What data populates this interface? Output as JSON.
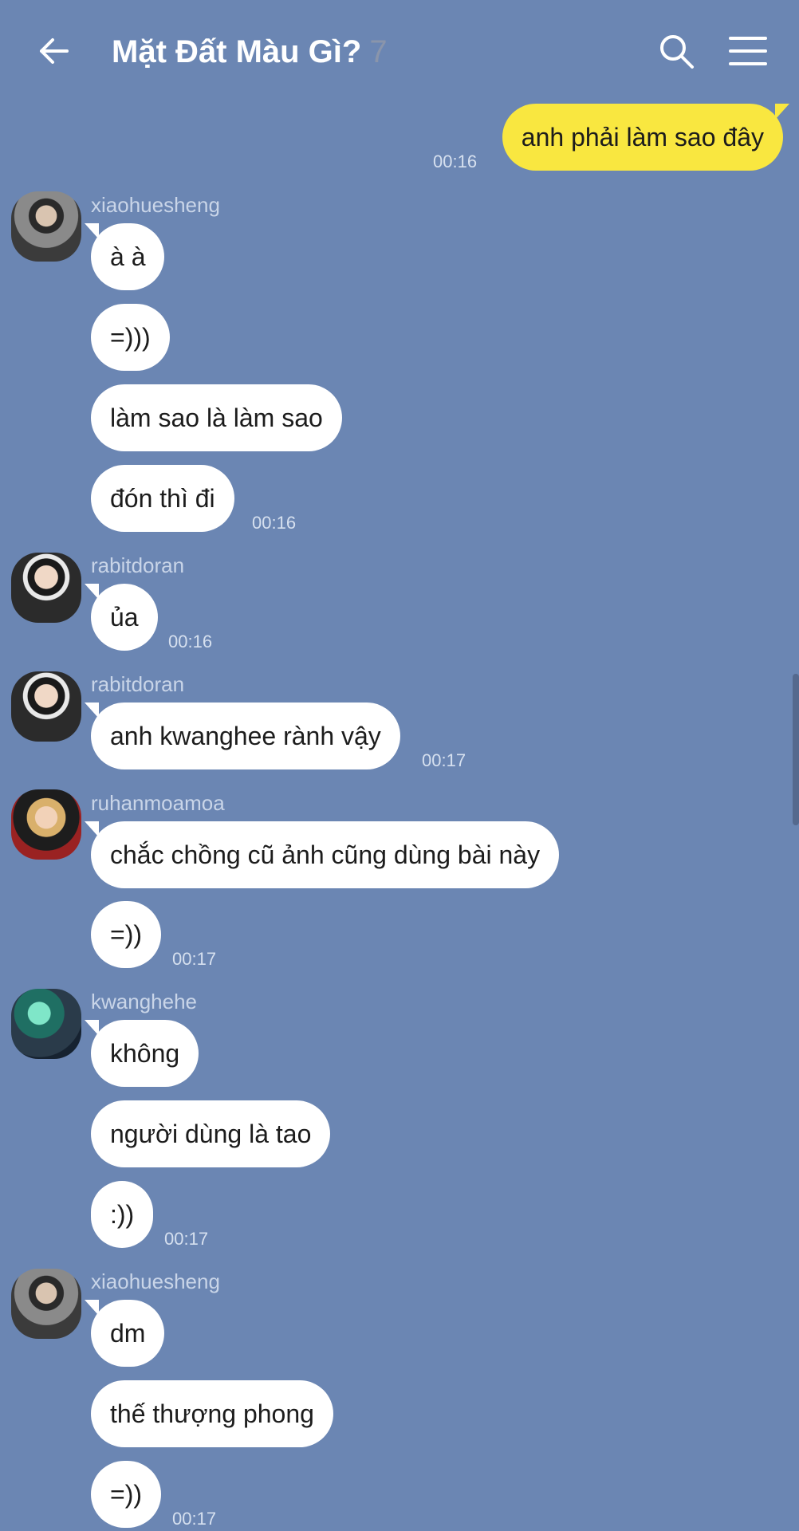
{
  "header": {
    "title": "Mặt Đất Màu Gì?",
    "member_count": "7",
    "icons": [
      "arrow-left-icon",
      "search-icon",
      "menu-icon"
    ]
  },
  "colors": {
    "background": "#6b86b3",
    "my_bubble": "#f9e740",
    "other_bubble": "#ffffff"
  },
  "messages": {
    "m0": {
      "text": "anh phải làm sao đây",
      "time": "00:16"
    },
    "g1": {
      "sender": "xiaohuesheng",
      "b0": "à à",
      "b1": "=)))",
      "b2": "làm sao là làm sao",
      "b3": "đón thì đi",
      "time": "00:16"
    },
    "g2": {
      "sender": "rabitdoran",
      "b0": "ủa",
      "time": "00:16"
    },
    "g3": {
      "sender": "rabitdoran",
      "b0": "anh kwanghee rành vậy",
      "time": "00:17"
    },
    "g4": {
      "sender": "ruhanmoamoa",
      "b0": "chắc chồng cũ ảnh cũng dùng bài này",
      "b1": "=))",
      "time": "00:17"
    },
    "g5": {
      "sender": "kwanghehe",
      "b0": "không",
      "b1": "người dùng là tao",
      "b2": ":))",
      "time": "00:17"
    },
    "g6": {
      "sender": "xiaohuesheng",
      "b0": "dm",
      "b1": "thế thượng phong",
      "b2": "=))",
      "time": "00:17"
    }
  }
}
